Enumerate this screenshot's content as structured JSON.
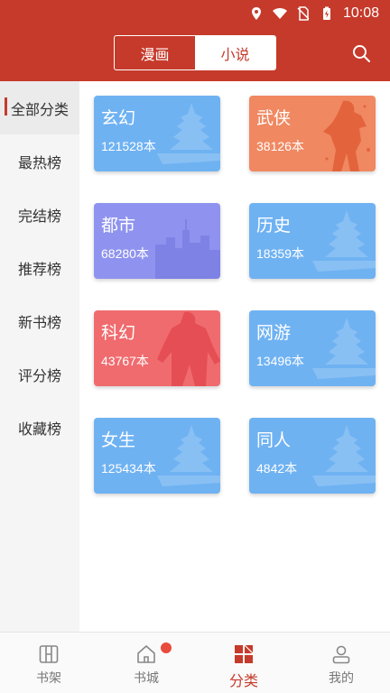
{
  "status": {
    "time": "10:08"
  },
  "header": {
    "tabs": [
      {
        "label": "漫画"
      },
      {
        "label": "小说"
      }
    ],
    "active_tab": "小说"
  },
  "sidebar": {
    "items": [
      {
        "label": "全部分类"
      },
      {
        "label": "最热榜"
      },
      {
        "label": "完结榜"
      },
      {
        "label": "推荐榜"
      },
      {
        "label": "新书榜"
      },
      {
        "label": "评分榜"
      },
      {
        "label": "收藏榜"
      }
    ]
  },
  "categories": [
    {
      "title": "玄幻",
      "count": "121528本",
      "color": "#6fb2f2"
    },
    {
      "title": "武侠",
      "count": "38126本",
      "color": "#f08861"
    },
    {
      "title": "都市",
      "count": "68280本",
      "color": "#8f93ef"
    },
    {
      "title": "历史",
      "count": "18359本",
      "color": "#6fb2f2"
    },
    {
      "title": "科幻",
      "count": "43767本",
      "color": "#f06b6e"
    },
    {
      "title": "网游",
      "count": "13496本",
      "color": "#6fb2f2"
    },
    {
      "title": "女生",
      "count": "125434本",
      "color": "#6fb2f2"
    },
    {
      "title": "同人",
      "count": "4842本",
      "color": "#6fb2f2"
    }
  ],
  "bottom_nav": {
    "items": [
      {
        "label": "书架",
        "icon": "bookshelf-icon"
      },
      {
        "label": "书城",
        "icon": "home-icon"
      },
      {
        "label": "分类",
        "icon": "category-icon"
      },
      {
        "label": "我的",
        "icon": "profile-icon"
      }
    ],
    "active": "分类"
  },
  "colors": {
    "accent": "#c63a2b",
    "badge": "#e94b3c"
  }
}
